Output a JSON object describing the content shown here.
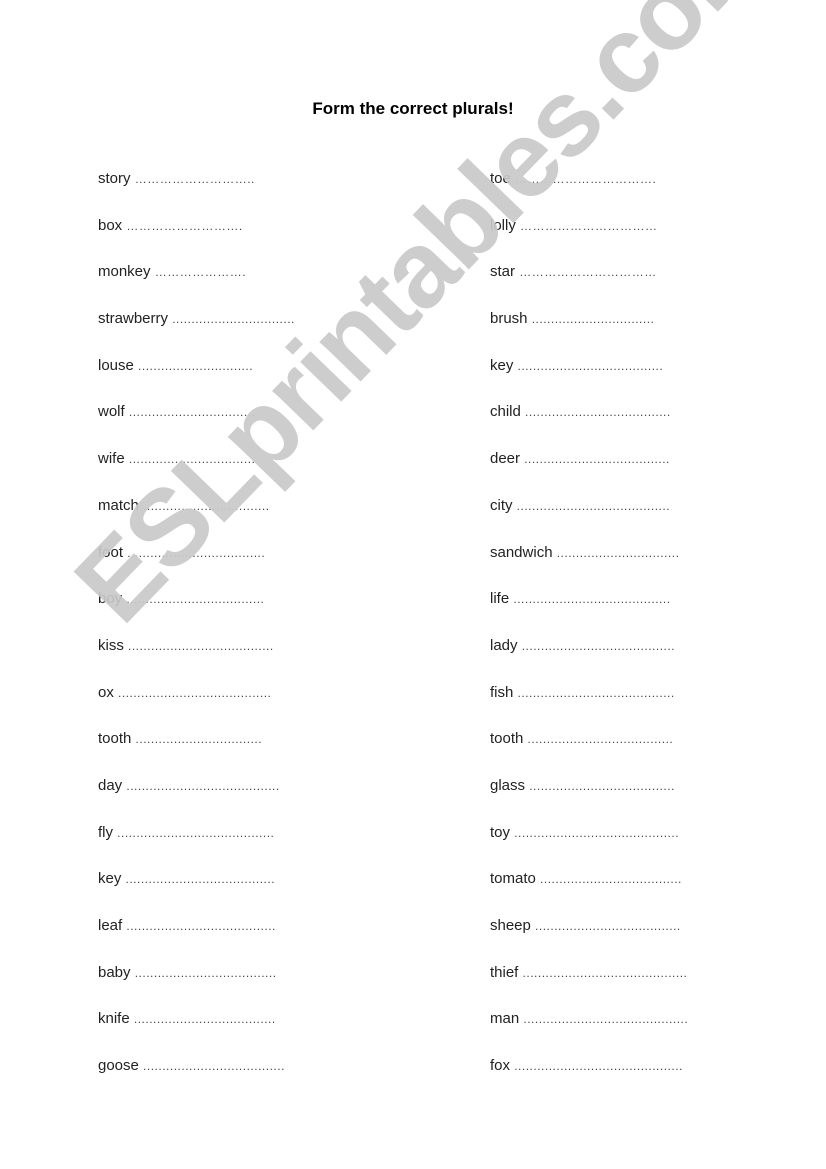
{
  "title": "Form the correct plurals!",
  "watermark": "ESLprintables.com",
  "left_column": [
    {
      "word": "story",
      "blank": "……………………….."
    },
    {
      "word": "box",
      "blank": "………………………."
    },
    {
      "word": "monkey",
      "blank": "…………………."
    },
    {
      "word": "strawberry",
      "blank": "................................"
    },
    {
      "word": "louse",
      "blank": ".............................."
    },
    {
      "word": "wolf",
      "blank": "................................."
    },
    {
      "word": "wife",
      "blank": "................................."
    },
    {
      "word": "match",
      "blank": "................................."
    },
    {
      "word": "foot",
      "blank": "...................................."
    },
    {
      "word": "boy",
      "blank": "...................................."
    },
    {
      "word": "kiss",
      "blank": "......................................"
    },
    {
      "word": "ox",
      "blank": "........................................"
    },
    {
      "word": "tooth",
      "blank": "................................."
    },
    {
      "word": "day",
      "blank": "........................................"
    },
    {
      "word": "fly",
      "blank": "........................................."
    },
    {
      "word": "key",
      "blank": "......................................."
    },
    {
      "word": "leaf",
      "blank": "......................................."
    },
    {
      "word": "baby",
      "blank": "....................................."
    },
    {
      "word": "knife",
      "blank": "....................................."
    },
    {
      "word": "goose",
      "blank": "....................................."
    }
  ],
  "right_column": [
    {
      "word": "toe",
      "blank": "……………………………."
    },
    {
      "word": "lolly",
      "blank": "……………………………"
    },
    {
      "word": "star",
      "blank": "……………………………"
    },
    {
      "word": "brush",
      "blank": "................................"
    },
    {
      "word": "key",
      "blank": "......................................"
    },
    {
      "word": "child",
      "blank": "......................................"
    },
    {
      "word": "deer",
      "blank": "......................................"
    },
    {
      "word": "city",
      "blank": "........................................"
    },
    {
      "word": "sandwich",
      "blank": "................................"
    },
    {
      "word": "life",
      "blank": "........................................."
    },
    {
      "word": "lady",
      "blank": "........................................"
    },
    {
      "word": "fish",
      "blank": "........................................."
    },
    {
      "word": "tooth",
      "blank": "......................................"
    },
    {
      "word": "glass",
      "blank": "......................................"
    },
    {
      "word": "toy",
      "blank": "..........................................."
    },
    {
      "word": "tomato",
      "blank": "....................................."
    },
    {
      "word": "sheep",
      "blank": "......................................"
    },
    {
      "word": "thief",
      "blank": "..........................................."
    },
    {
      "word": "man",
      "blank": "..........................................."
    },
    {
      "word": "fox",
      "blank": "............................................"
    }
  ]
}
